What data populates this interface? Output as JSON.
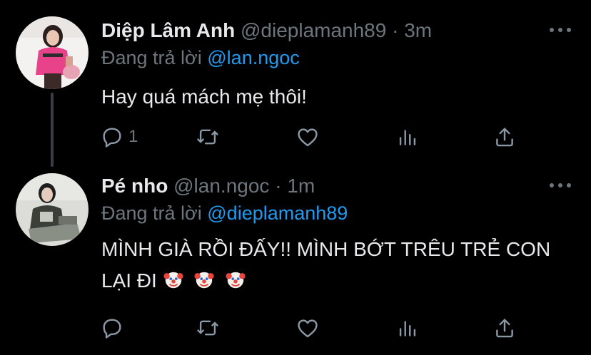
{
  "tweets": [
    {
      "name": "Diệp Lâm Anh",
      "handle": "@dieplamanh89",
      "separator": "·",
      "time": "3m",
      "replying_prefix": "Đang trả lời ",
      "replying_to": "@lan.ngoc",
      "text": "Hay quá mách mẹ thôi!",
      "reply_count": "1",
      "avatar_palette": [
        "#e8428a",
        "#f2f2f2",
        "#3b2a27"
      ]
    },
    {
      "name": "Pé nho",
      "handle": "@lan.ngoc",
      "separator": "·",
      "time": "1m",
      "replying_prefix": "Đang trả lời ",
      "replying_to": "@dieplamanh89",
      "text": "MÌNH GIÀ RỒI ĐẤY!! MÌNH BỚT TRÊU TRẺ CON LẠI ĐI",
      "emoji": [
        "clown-face-icon",
        "clown-face-icon",
        "clown-face-icon"
      ],
      "reply_count": "",
      "avatar_palette": [
        "#dcdcd8",
        "#3c3e3a",
        "#8a8f86"
      ]
    }
  ],
  "colors": {
    "background": "#000000",
    "text_primary": "#e7e9ea",
    "text_secondary": "#6e767d",
    "accent": "#1d9bf0",
    "thread_line": "#3a3d41"
  },
  "icons": {
    "reply": "reply-icon",
    "retweet": "retweet-icon",
    "like": "heart-icon",
    "analytics": "analytics-icon",
    "share": "share-icon",
    "more": "more-options-icon"
  }
}
